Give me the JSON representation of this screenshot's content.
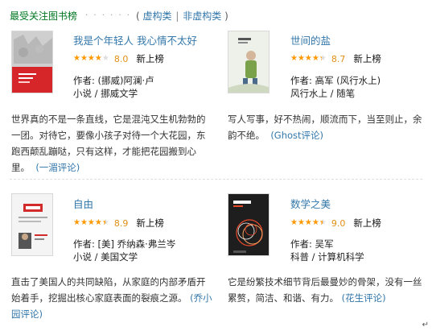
{
  "header": {
    "title": "最受关注图书榜",
    "dots": "· · · · · ·",
    "open_paren": "(",
    "link_fiction": "虚构类",
    "separator": "|",
    "link_nonfiction": "非虚构类",
    "close_paren": ")"
  },
  "books": [
    {
      "title": "我是个年轻人 我心情不太好",
      "rating": 8.0,
      "rating_text": "8.0",
      "badge": "新上榜",
      "author": "作者: (挪威)阿澜·卢",
      "category": "小说 / 挪威文学",
      "desc_lines": [
        "世界真的不是一条直线，它是混沌又生机勃勃的",
        "一团。对待它，要像小孩子对待一个大花园，东",
        "跑西颠乱蹦哒，只有这样，才能把花园搬到心"
      ],
      "desc_last": "里。",
      "review": "(一湄评论)",
      "cover_colors": {
        "top": "#c9c9c9",
        "band": "#d6262a"
      }
    },
    {
      "title": "世间的盐",
      "rating": 8.7,
      "rating_text": "8.7",
      "badge": "新上榜",
      "author": "作者: 高军 (风行水上)",
      "category": "风行水上 / 随笔",
      "desc_lines": [
        "写人写事，好不热闹，顺流而下，当至则止，余"
      ],
      "desc_last": "韵不绝。",
      "review": "(Ghost评论)",
      "cover_colors": {
        "top": "#eef0ea",
        "band": "#7aa24a"
      }
    },
    {
      "title": "自由",
      "rating": 8.9,
      "rating_text": "8.9",
      "badge": "新上榜",
      "author": "作者: [美] 乔纳森·弗兰岑",
      "category": "小说 / 美国文学",
      "desc_lines": [
        "直击了美国人的共同缺陷，从家庭的内部矛盾开",
        "始着手，挖掘出核心家庭表面的裂痕之源。"
      ],
      "desc_inline_review": "(乔小",
      "desc_last": "园评论)",
      "review": "",
      "cover_colors": {
        "top": "#f2f2f2",
        "band": "#d12b2b"
      }
    },
    {
      "title": "数学之美",
      "rating": 9.0,
      "rating_text": "9.0",
      "badge": "新上榜",
      "author": "作者: 吴军",
      "category": "科普 / 计算机科学",
      "desc_lines": [
        "它是纷繁技术细节背后最曼妙的骨架，没有一丝"
      ],
      "desc_last": "累赘，简洁、和谐、有力。",
      "review": "(花生评论)",
      "cover_colors": {
        "top": "#1e1e1e",
        "band": "#e94a2a"
      }
    }
  ],
  "star_glyphs": "★★★★★",
  "colors": {
    "link": "#3377aa",
    "title_green": "#007722",
    "star": "#ff9900",
    "score": "#e09015"
  },
  "scroll_mark": "↵"
}
